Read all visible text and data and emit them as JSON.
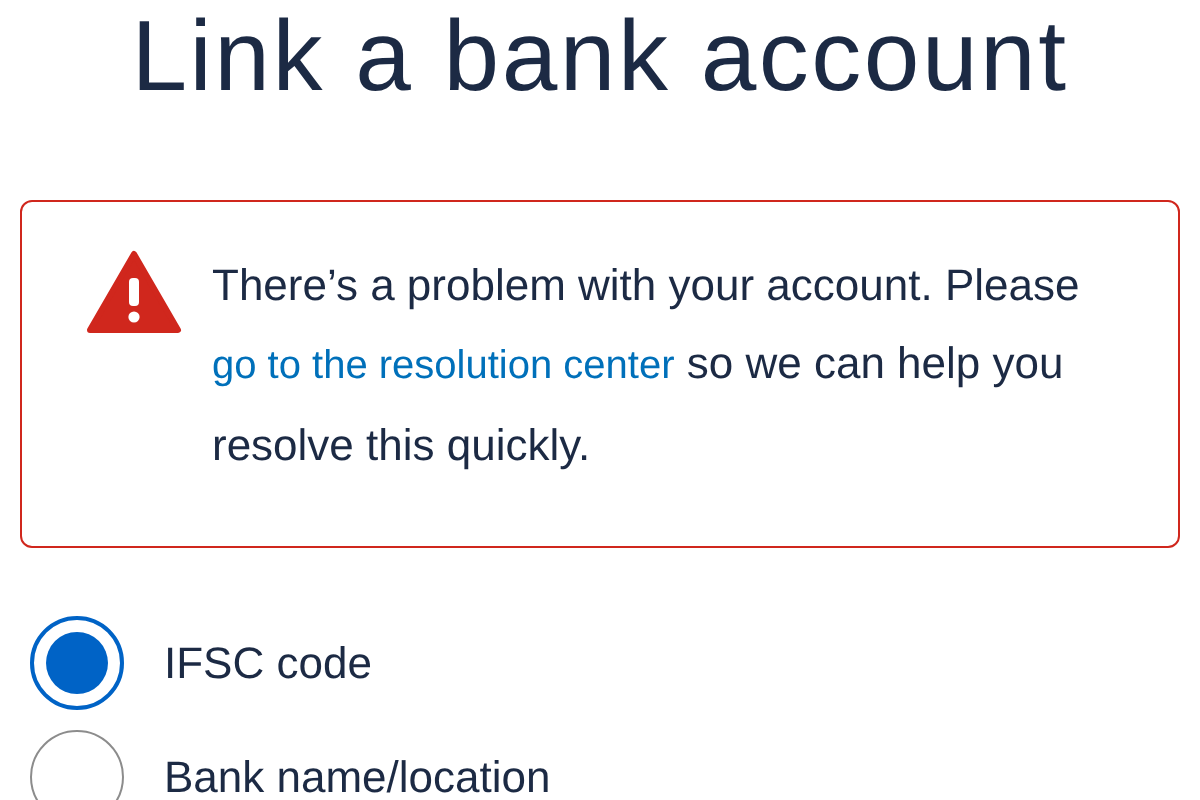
{
  "title": "Link a bank account",
  "alert": {
    "line_before": "There’s a problem with your account. Please",
    "link": "go to the resolution center",
    "line_after": "so we can help you resolve this quickly."
  },
  "options": [
    {
      "label": "IFSC code",
      "selected": true
    },
    {
      "label": "Bank name/location",
      "selected": false
    }
  ]
}
